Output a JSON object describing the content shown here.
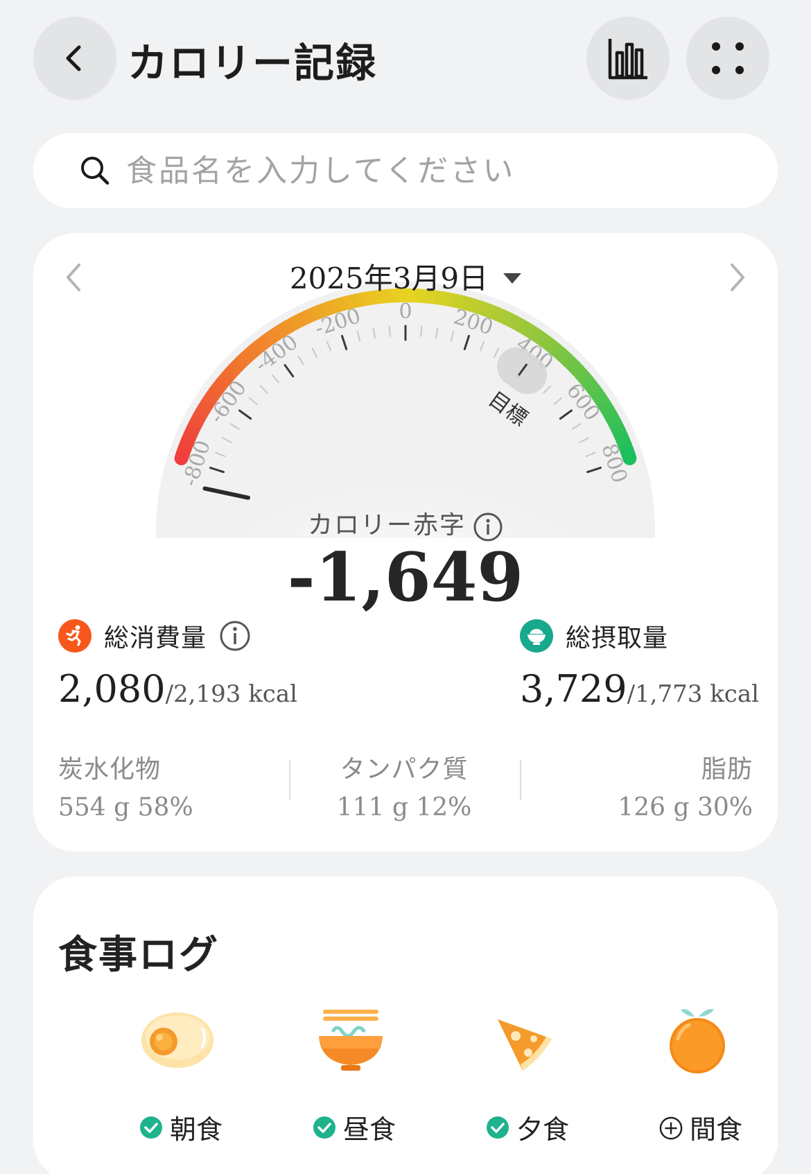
{
  "header": {
    "title": "カロリー記録"
  },
  "search": {
    "placeholder": "食品名を入力してください"
  },
  "summary": {
    "date": "2025年3月9日",
    "gauge": {
      "min": -800,
      "max": 800,
      "ticks": [
        "-800",
        "-600",
        "-400",
        "-200",
        "0",
        "200",
        "400",
        "600",
        "800"
      ],
      "target_value": 400,
      "target_label": "目標",
      "current_value": -1649,
      "colors": [
        "#ef3e3c",
        "#f18a2b",
        "#e8d320",
        "#8cc63f",
        "#19bf5e"
      ]
    },
    "deficit_label": "カロリー赤字",
    "deficit_value": "-1,649",
    "burn": {
      "label": "総消費量",
      "value": "2,080",
      "target": "/2,193 kcal",
      "color": "#f7571d"
    },
    "intake": {
      "label": "総摂取量",
      "value": "3,729",
      "target": "/1,773 kcal",
      "color": "#17a98e"
    },
    "macros": [
      {
        "name": "炭水化物",
        "value": "554 g  58%"
      },
      {
        "name": "タンパク質",
        "value": "111 g  12%"
      },
      {
        "name": "脂肪",
        "value": "126 g  30%"
      }
    ]
  },
  "meal_log": {
    "title": "食事ログ",
    "meals": [
      {
        "label": "朝食",
        "status": "checked",
        "icon": "egg-icon"
      },
      {
        "label": "昼食",
        "status": "checked",
        "icon": "noodle-bowl-icon"
      },
      {
        "label": "夕食",
        "status": "checked",
        "icon": "pizza-icon"
      },
      {
        "label": "間食",
        "status": "add",
        "icon": "orange-icon"
      }
    ]
  }
}
